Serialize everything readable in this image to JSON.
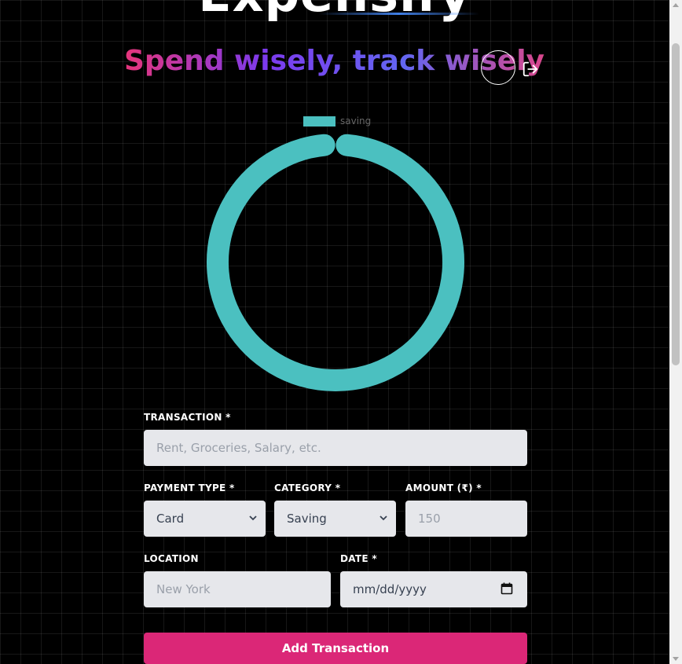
{
  "app": {
    "title": "Expensify",
    "tagline": "Spend wisely, track wisely"
  },
  "icons": {
    "avatar": "avatar-circle",
    "logout": "logout-icon"
  },
  "chart_data": {
    "type": "pie",
    "variant": "doughnut",
    "categories": [
      "saving"
    ],
    "values": [
      100
    ],
    "colors": [
      "#4bc0c0"
    ],
    "legend": "top",
    "title": ""
  },
  "form": {
    "transaction": {
      "label": "TRANSACTION *",
      "placeholder": "Rent, Groceries, Salary, etc."
    },
    "payment_type": {
      "label": "PAYMENT TYPE *",
      "value": "Card"
    },
    "category": {
      "label": "CATEGORY *",
      "value": "Saving"
    },
    "amount": {
      "label": "AMOUNT (₹) *",
      "placeholder": "150"
    },
    "location": {
      "label": "LOCATION",
      "placeholder": "New York"
    },
    "date": {
      "label": "DATE *",
      "placeholder": "mm/dd/yyyy"
    },
    "submit_label": "Add Transaction"
  },
  "colors": {
    "background": "#000000",
    "accent": "#db2777",
    "chart_saving": "#4bc0c0",
    "field_bg": "#e6e7eb"
  }
}
